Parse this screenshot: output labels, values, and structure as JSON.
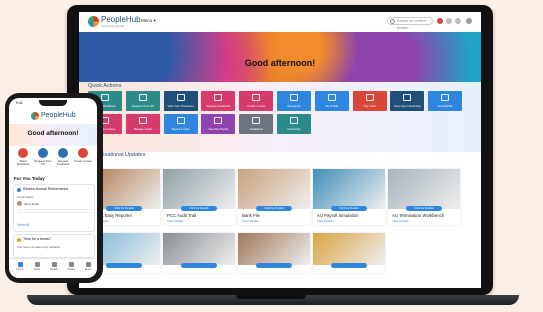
{
  "app": {
    "name": "PeopleHub",
    "tagline": "Employee Portal",
    "menu_label": "Menu ▾",
    "search_placeholder": "Search for content, people...",
    "greeting": "Good afternoon!"
  },
  "quick_actions": {
    "title": "Quick Actions",
    "tiles": [
      {
        "label": "Talent Workflows",
        "color": "#2d8a8a"
      },
      {
        "label": "Request Time Off",
        "color": "#2d8a8a"
      },
      {
        "label": "View Your Timesheet",
        "color": "#1f4e79"
      },
      {
        "label": "Request Feedback",
        "color": "#d63c6b"
      },
      {
        "label": "Create a Case",
        "color": "#d63c6b"
      },
      {
        "label": "Recognize",
        "color": "#2e86de"
      },
      {
        "label": "My Profile",
        "color": "#2e86de"
      },
      {
        "label": "Org Chart",
        "color": "#d8483a"
      },
      {
        "label": "View Open Vacancies",
        "color": "#1f4e79"
      },
      {
        "label": "Annual Plan",
        "color": "#2e86de"
      },
      {
        "label": "Expense Invoice",
        "color": "#d63c6b"
      },
      {
        "label": "Manage Goals",
        "color": "#d63c6b"
      },
      {
        "label": "Report a Case",
        "color": "#2e86de"
      },
      {
        "label": "View My Payslip",
        "color": "#8e44ad"
      },
      {
        "label": "Guidelines",
        "color": "#6b7580"
      },
      {
        "label": "Favourites",
        "color": "#2d8a8a"
      }
    ]
  },
  "updates": {
    "title": "Organisational Updates",
    "cards": [
      {
        "title": "Talent Easy Reporter",
        "link": "View Details",
        "pill": "Click for Details",
        "img": "#b07a4f"
      },
      {
        "title": "PCC Audit Trail",
        "link": "View Details",
        "pill": "Click for Details",
        "img": "#8fa0a8"
      },
      {
        "title": "Bank File",
        "link": "View Details",
        "pill": "Click for Details",
        "img": "#c9a27c"
      },
      {
        "title": "AU Payroll Simulation",
        "link": "View Details",
        "pill": "Click for Details",
        "img": "#3f8fb8"
      },
      {
        "title": "AU Termination Workbench",
        "link": "View Details",
        "pill": "Click for Details",
        "img": "#a6b4bd"
      },
      {
        "title": "",
        "img": "#7fb6d9"
      },
      {
        "title": "",
        "img": "#8a8f94"
      },
      {
        "title": "",
        "img": "#a0785a"
      },
      {
        "title": "",
        "img": "#d9a441"
      }
    ]
  },
  "phone": {
    "time": "9:41",
    "app_name": "PeopleHub",
    "greeting": "Good afternoon!",
    "icons": [
      {
        "label": "Talent Workflows",
        "color": "#d8483a"
      },
      {
        "label": "Request Time Off",
        "color": "#2e6fb0"
      },
      {
        "label": "Request Feedback",
        "color": "#2e6fb0"
      },
      {
        "label": "Create a Case",
        "color": "#d8483a"
      }
    ],
    "for_you_title": "For You Today",
    "task_title": "Review Annual Performance",
    "task_sub": "Confirmation",
    "person": "Jane Smith",
    "view_all": "View All",
    "card2_title": "Time for a break?",
    "card2_text": "You have not taken any vacation",
    "nav": [
      "Home",
      "Alerts",
      "Search",
      "Profile",
      "More"
    ]
  },
  "colors": {
    "accent": "#2e86de",
    "brand": "#1f4e79"
  }
}
